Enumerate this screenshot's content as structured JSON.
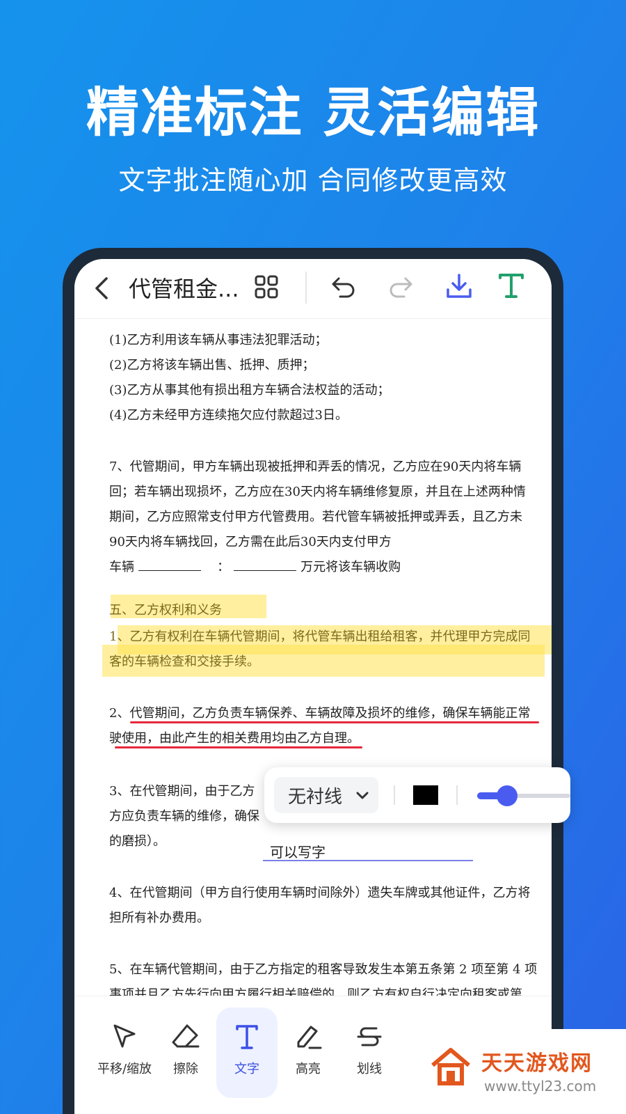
{
  "promo": {
    "headline": "精准标注 灵活编辑",
    "subheadline": "文字批注随心加 合同修改更高效"
  },
  "topbar": {
    "back_icon": "chevron-left-icon",
    "document_title": "代管租金...",
    "icons": [
      "grid-icon",
      "undo-icon",
      "redo-icon",
      "download-icon",
      "text-tool-icon"
    ],
    "colors": {
      "download": "#4a5cf0",
      "text_tool": "#22a06b",
      "redo_disabled": "#bbbbbb"
    }
  },
  "document": {
    "lines": [
      "(1)乙方利用该车辆从事违法犯罪活动；",
      "(2)乙方将该车辆出售、抵押、质押；",
      "(3)乙方从事其他有损出租方车辆合法权益的活动；",
      "(4)乙方未经甲方连续拖欠应付款超过3日。",
      "7、代管期间，甲方车辆出现被抵押和弄丢的情况，乙方应在90天内将车辆",
      "回；若车辆出现损坏，乙方应在30天内将车辆维修复原，并且在上述两种情",
      "期间，乙方应照常支付甲方代管费用。若代管车辆被抵押或弄丢，且乙方未",
      "90天内将车辆找回，乙方需在此后30天内支付甲方",
      "车辆",
      "：",
      "万元将该车辆收购",
      "五、乙方权利和义务",
      "1、乙方有权利在车辆代管期间，将代管车辆出租给租客，并代理甲方完成同",
      "客的车辆检查和交接手续。",
      "2、代管期间，乙方负责车辆保养、车辆故障及损坏的维修，确保车辆能正常",
      "驶使用，由此产生的相关费用均由乙方自理。",
      "3、在代管期间，由于乙方",
      "方应负责车辆的维修，确保",
      "的磨损）。",
      "4、在代管期间（甲方自行使用车辆时间除外）遗失车牌或其他证件，乙方将",
      "担所有补办费用。",
      "5、在车辆代管期间，由于乙方指定的租客导致发生本第五条第 2 项至第 4 项",
      "事项并且乙方先行向甲方履行相关赔偿的，则乙方有权自行决定向租客或第"
    ],
    "highlight_color": "#ffe250",
    "underline_color": "#e6283c"
  },
  "font_popup": {
    "font_name": "无衬线",
    "chevron_icon": "chevron-down-icon",
    "color_value": "#000000",
    "size_level": 0.25
  },
  "typed_annotation": {
    "text": "可以写字",
    "underline_color": "#7b7fe8"
  },
  "toolbar": {
    "tools": [
      {
        "label": "平移/缩放",
        "icon": "pointer-icon"
      },
      {
        "label": "擦除",
        "icon": "eraser-icon"
      },
      {
        "label": "文字",
        "icon": "text-icon",
        "active": true
      },
      {
        "label": "高亮",
        "icon": "highlighter-icon"
      },
      {
        "label": "划线",
        "icon": "strikethrough-icon"
      }
    ],
    "active_color": "#3c50e6"
  },
  "watermark": {
    "name": "天天游戏网",
    "url": "www.ttyl23.com",
    "logo_icon": "house-logo-icon"
  }
}
